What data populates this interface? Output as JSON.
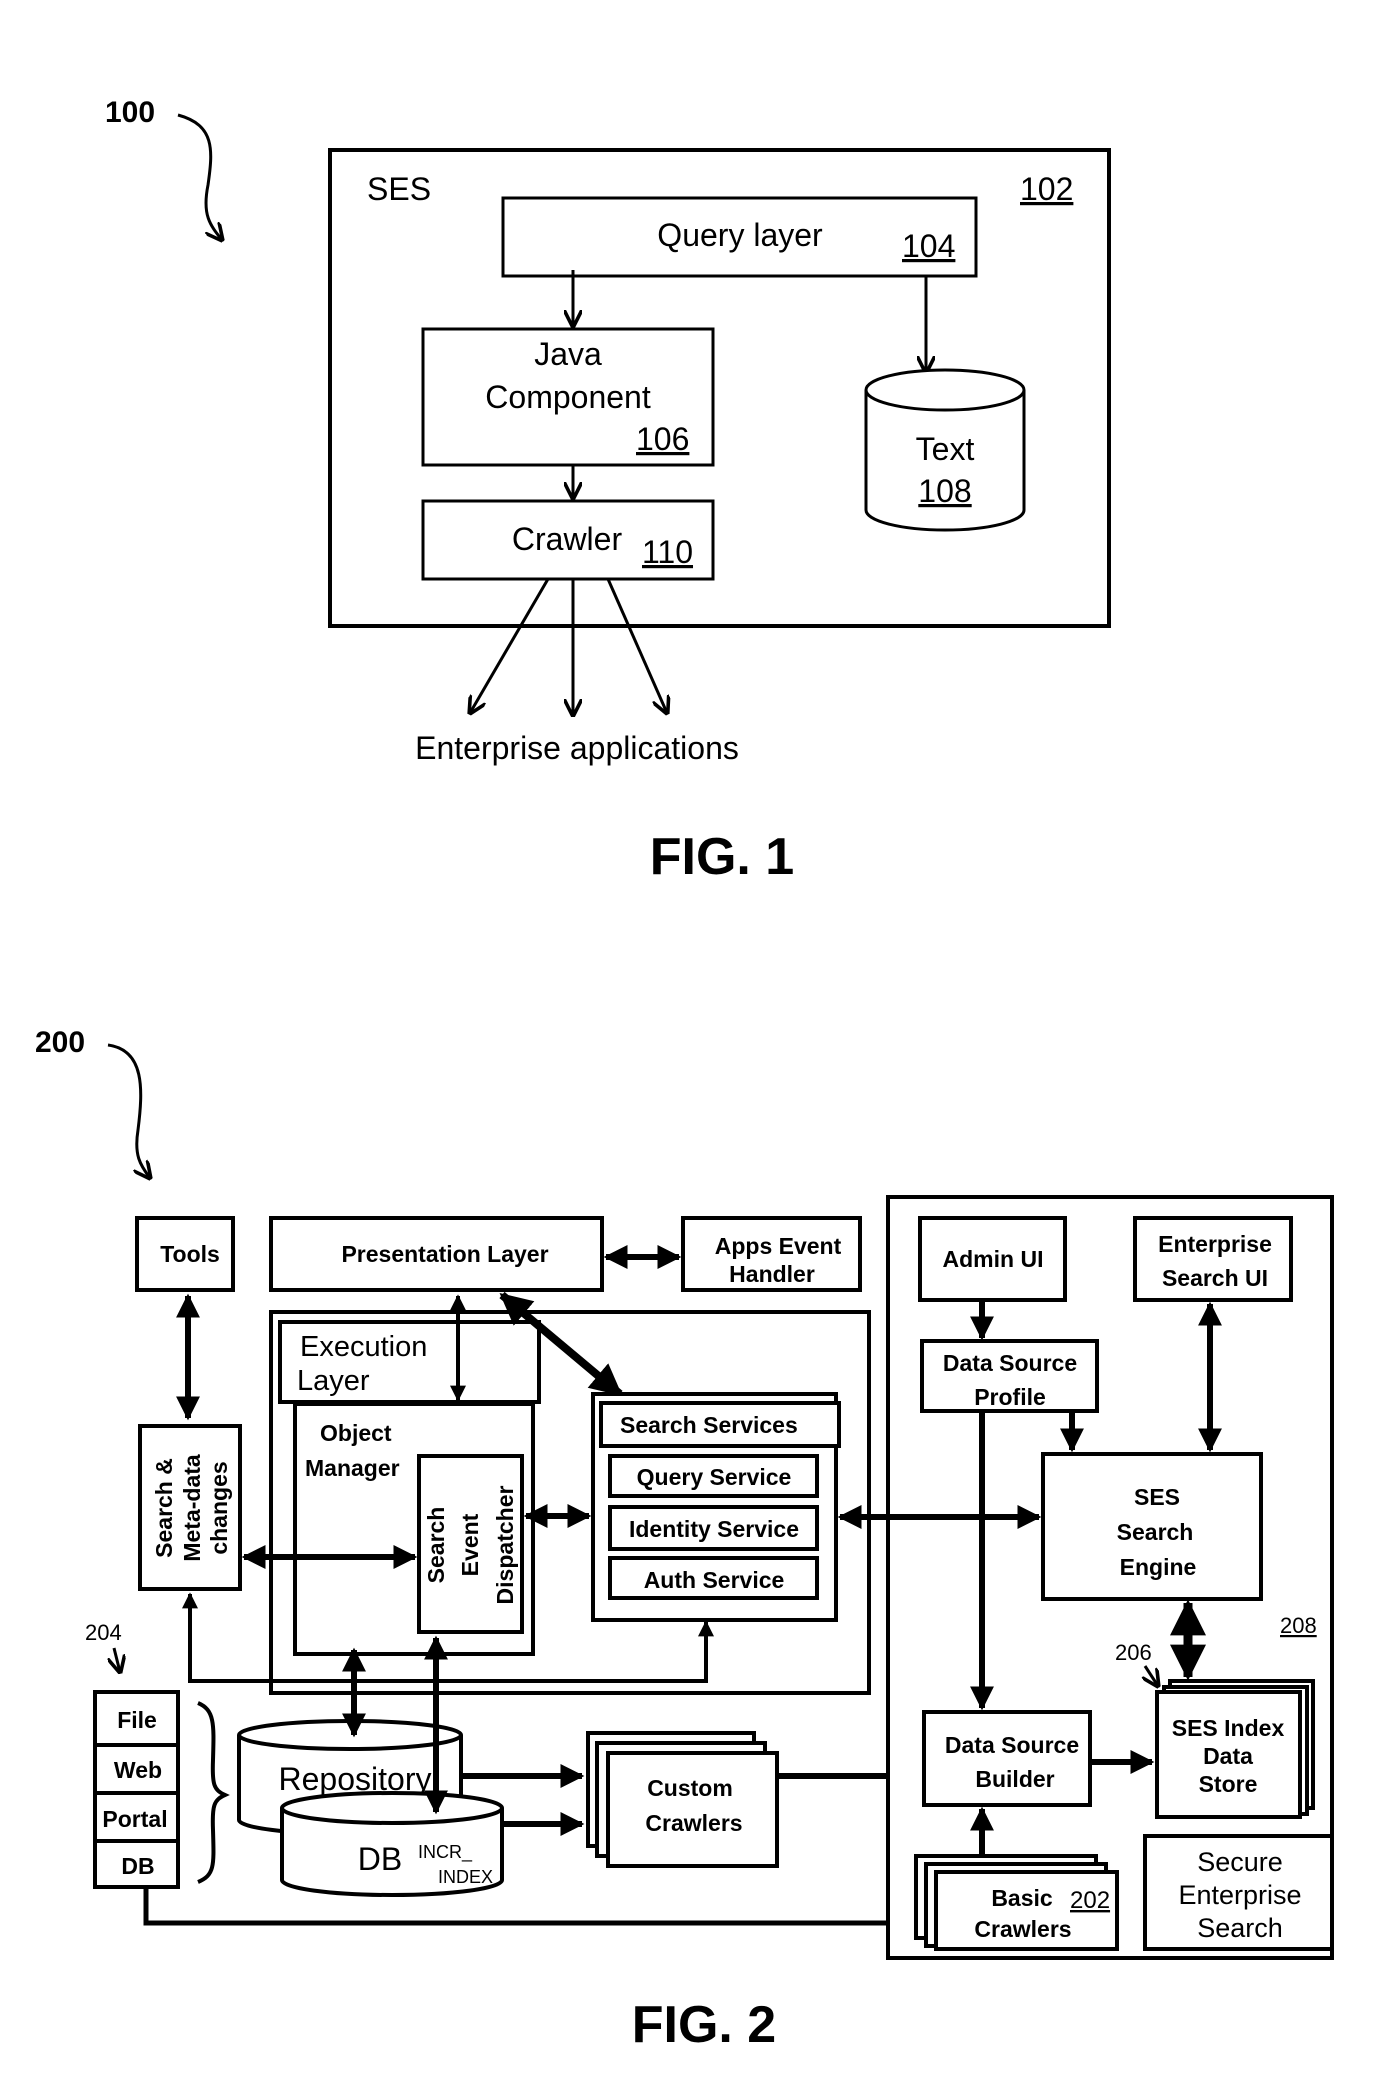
{
  "fig1": {
    "ref_label": "100",
    "ses_label": "SES",
    "ses_ref": "102",
    "query_layer": {
      "label": "Query layer",
      "ref": "104"
    },
    "java_component": {
      "line1": "Java",
      "line2": "Component",
      "ref": "106"
    },
    "text_store": {
      "label": "Text",
      "ref": "108"
    },
    "crawler": {
      "label": "Crawler",
      "ref": "110"
    },
    "enterprise_apps": "Enterprise applications",
    "caption": "FIG. 1"
  },
  "fig2": {
    "ref_label": "200",
    "tools": "Tools",
    "presentation_layer": "Presentation Layer",
    "apps_event_handler": {
      "line1": "Apps Event",
      "line2": "Handler"
    },
    "execution_layer": {
      "line1": "Execution",
      "line2": "Layer"
    },
    "object_manager": {
      "line1": "Object",
      "line2": "Manager"
    },
    "search_event_dispatcher": {
      "line1": "Search",
      "line2": "Event",
      "line3": "Dispatcher"
    },
    "search_meta": {
      "line1": "Search &",
      "line2": "Meta-data",
      "line3": "changes"
    },
    "search_services": {
      "header": "Search Services",
      "items": [
        "Query Service",
        "Identity Service",
        "Auth Service"
      ]
    },
    "sources_ref": "204",
    "sources": [
      "File",
      "Web",
      "Portal",
      "DB"
    ],
    "repository": "Repository",
    "db": {
      "label": "DB",
      "line1": "INCR_",
      "line2": "INDEX"
    },
    "custom_crawlers": {
      "line1": "Custom",
      "line2": "Crawlers"
    },
    "admin_ui": "Admin UI",
    "enterprise_search_ui": {
      "line1": "Enterprise",
      "line2": "Search UI"
    },
    "data_source_profile": {
      "line1": "Data Source",
      "line2": "Profile"
    },
    "ses_search_engine": {
      "line1": "SES",
      "line2": "Search",
      "line3": "Engine"
    },
    "ses_ref": "208",
    "index_ref": "206",
    "ses_index_store": {
      "line1": "SES Index",
      "line2": "Data",
      "line3": "Store"
    },
    "data_source_builder": {
      "line1": "Data Source",
      "line2": "Builder"
    },
    "basic_crawlers": {
      "line1": "Basic",
      "line2": "Crawlers",
      "ref": "202"
    },
    "secure_enterprise_search": {
      "line1": "Secure",
      "line2": "Enterprise",
      "line3": "Search"
    },
    "caption": "FIG. 2"
  }
}
